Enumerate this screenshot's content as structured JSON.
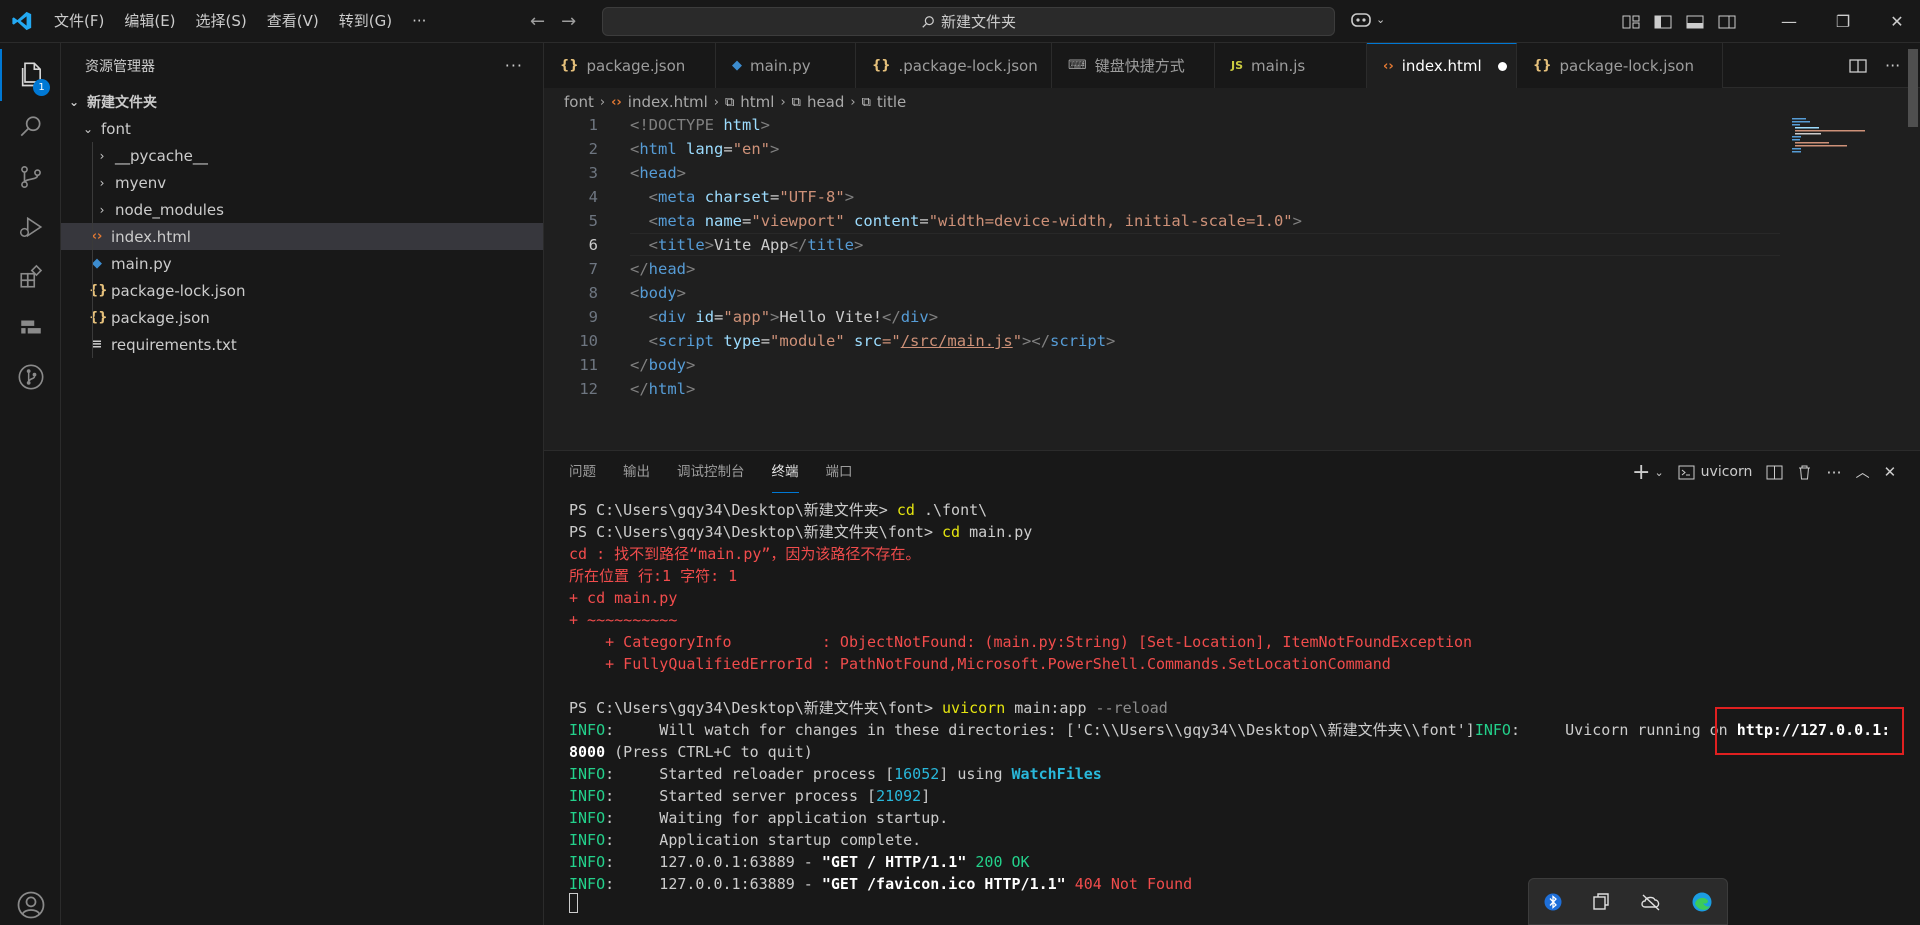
{
  "titlebar": {
    "menus": [
      "文件(F)",
      "编辑(E)",
      "选择(S)",
      "查看(V)",
      "转到(G)",
      "···"
    ],
    "search_text": "新建文件夹"
  },
  "activity": {
    "explorer_badge": "1"
  },
  "sidebar": {
    "title": "资源管理器",
    "more": "···",
    "root": "新建文件夹",
    "items": [
      {
        "label": "font",
        "kind": "folder-open"
      },
      {
        "label": "__pycache__",
        "kind": "folder"
      },
      {
        "label": "myenv",
        "kind": "folder"
      },
      {
        "label": "node_modules",
        "kind": "folder"
      },
      {
        "label": "index.html",
        "kind": "html"
      },
      {
        "label": "main.py",
        "kind": "python"
      },
      {
        "label": "package-lock.json",
        "kind": "json"
      },
      {
        "label": "package.json",
        "kind": "json"
      },
      {
        "label": "requirements.txt",
        "kind": "text"
      }
    ]
  },
  "tabs": [
    {
      "label": "package.json",
      "icon": "{}"
    },
    {
      "label": "main.py",
      "icon": "py"
    },
    {
      "label": ".package-lock.json",
      "icon": "{}"
    },
    {
      "label": "键盘快捷方式",
      "icon": "kb"
    },
    {
      "label": "main.js",
      "icon": "JS"
    },
    {
      "label": "index.html",
      "icon": "<>"
    },
    {
      "label": "package-lock.json",
      "icon": "{}"
    }
  ],
  "breadcrumb": [
    "font",
    "index.html",
    "html",
    "head",
    "title"
  ],
  "editor": {
    "line_numbers": [
      "1",
      "2",
      "3",
      "4",
      "5",
      "6",
      "7",
      "8",
      "9",
      "10",
      "11",
      "12"
    ],
    "current_line": "6",
    "lines": {
      "l1": {
        "a": "<!DOCTYPE",
        "b": "html",
        "c": ">"
      },
      "l2": {
        "a": "<",
        "tag": "html",
        "attr": "lang",
        "eq": "=",
        "val": "\"en\"",
        "z": ">"
      },
      "l3": {
        "a": "<",
        "tag": "head",
        "z": ">"
      },
      "l4": {
        "a": "<",
        "tag": "meta",
        "attr": "charset",
        "eq": "=",
        "val": "\"UTF-8\"",
        "z": ">"
      },
      "l5": {
        "a": "<",
        "tag": "meta",
        "attr1": "name",
        "val1": "\"viewport\"",
        "attr2": "content",
        "val2": "\"width=device-width, initial-scale=1.0\"",
        "z": ">"
      },
      "l6": {
        "a": "<",
        "tag": "title",
        "z": ">",
        "text": "Vite App",
        "close": "</",
        "ctag": "title",
        "cz": ">"
      },
      "l7": {
        "a": "</",
        "tag": "head",
        "z": ">"
      },
      "l8": {
        "a": "<",
        "tag": "body",
        "z": ">"
      },
      "l9": {
        "a": "<",
        "tag": "div",
        "attr": "id",
        "eq": "=",
        "val": "\"app\"",
        "z": ">",
        "text": "Hello Vite!",
        "close": "</",
        "ctag": "div",
        "cz": ">"
      },
      "l10": {
        "a": "<",
        "tag": "script",
        "attr1": "type",
        "val1": "\"module\"",
        "attr2": "src",
        "q1": "=\"",
        "link": "/src/main.js",
        "q2": "\"",
        "z": ">",
        "close": "</",
        "ctag": "script",
        "cz": ">"
      },
      "l11": {
        "a": "</",
        "tag": "body",
        "z": ">"
      },
      "l12": {
        "a": "</",
        "tag": "html",
        "z": ">"
      }
    }
  },
  "panel": {
    "tabs": [
      "问题",
      "输出",
      "调试控制台",
      "终端",
      "端口"
    ],
    "active_tab": "终端",
    "terminal_name": "uvicorn",
    "plus": "+"
  },
  "terminal": {
    "l1_prompt": "PS C:\\Users\\gqy34\\Desktop\\新建文件夹> ",
    "l1_cmd": "cd",
    "l1_arg": " .\\font\\",
    "l2_prompt": "PS C:\\Users\\gqy34\\Desktop\\新建文件夹\\font> ",
    "l2_cmd": "cd",
    "l2_arg": " main.py",
    "err1": "cd : 找不到路径“main.py”，因为该路径不存在。",
    "err2": "所在位置 行:1 字符: 1",
    "err3": "+ cd main.py",
    "err4": "+ ~~~~~~~~~~",
    "err5": "    + CategoryInfo          : ObjectNotFound: (main.py:String) [Set-Location], ItemNotFoundException",
    "err6": "    + FullyQualifiedErrorId : PathNotFound,Microsoft.PowerShell.Commands.SetLocationCommand",
    "l3_prompt": "PS C:\\Users\\gqy34\\Desktop\\新建文件夹\\font> ",
    "l3_cmd": "uvicorn",
    "l3_arg": " main:app",
    "l3_flag": " --reload",
    "info": "INFO",
    "i1_text": ":     Will watch for changes in these directories: ['C:\\\\Users\\\\gqy34\\\\Desktop\\\\新建文件夹\\\\font']",
    "i1_info2": "INFO",
    "i1_text2": ":     Uvicorn running on ",
    "i1_url": "http://127.0.0.1:",
    "i1_url2": "8000",
    "i1_tail": " (Press CTRL+C to quit)",
    "i2_text": ":     Started reloader process [",
    "i2_pid": "16052",
    "i2_mid": "] using ",
    "i2_tool": "WatchFiles",
    "i3_text": ":     Started server process [",
    "i3_pid": "21092",
    "i3_end": "]",
    "i4_text": ":     Waiting for application startup.",
    "i5_text": ":     Application startup complete.",
    "i6_text": ":     127.0.0.1:63889 - ",
    "i6_req": "\"GET / HTTP/1.1\"",
    "i6_status": " 200 OK",
    "i7_text": ":     127.0.0.1:63889 - ",
    "i7_req": "\"GET /favicon.ico HTTP/1.1\"",
    "i7_status": " 404 Not Found",
    "bracket_close": "]"
  },
  "colors": {
    "accent": "#0078d4",
    "highlight_box": "#e02020"
  },
  "tray_icons": [
    "bluetooth-icon",
    "copy-icon",
    "cloud-off-icon",
    "edge-icon"
  ]
}
